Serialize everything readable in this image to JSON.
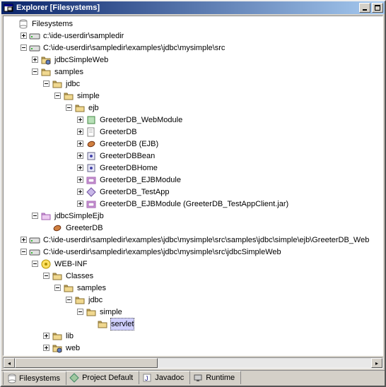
{
  "window": {
    "title": "Explorer [Filesystems]"
  },
  "tree": [
    {
      "i": 0,
      "t": "",
      "k": "filesystems",
      "label": "Filesystems",
      "icon": "filesystems"
    },
    {
      "i": 1,
      "t": "+",
      "k": "drive",
      "label": "c:\\ide-userdir\\sampledir",
      "icon": "drive"
    },
    {
      "i": 1,
      "t": "-",
      "k": "drive",
      "label": "C:\\ide-userdir\\sampledir\\examples\\jdbc\\mysimple\\src",
      "icon": "drive"
    },
    {
      "i": 2,
      "t": "+",
      "k": "webfolder",
      "label": "jdbcSimpleWeb",
      "icon": "webfolder"
    },
    {
      "i": 2,
      "t": "-",
      "k": "folder",
      "label": "samples",
      "icon": "folder"
    },
    {
      "i": 3,
      "t": "-",
      "k": "folder",
      "label": "jdbc",
      "icon": "folder"
    },
    {
      "i": 4,
      "t": "-",
      "k": "folder",
      "label": "simple",
      "icon": "folder"
    },
    {
      "i": 5,
      "t": "-",
      "k": "folder",
      "label": "ejb",
      "icon": "folder"
    },
    {
      "i": 6,
      "t": "+",
      "k": "web",
      "label": "GreeterDB_WebModule",
      "icon": "web"
    },
    {
      "i": 6,
      "t": "+",
      "k": "doc",
      "label": "GreeterDB",
      "icon": "doc"
    },
    {
      "i": 6,
      "t": "+",
      "k": "bean",
      "label": "GreeterDB (EJB)",
      "icon": "bean"
    },
    {
      "i": 6,
      "t": "+",
      "k": "class",
      "label": "GreeterDBBean",
      "icon": "class"
    },
    {
      "i": 6,
      "t": "+",
      "k": "class",
      "label": "GreeterDBHome",
      "icon": "class"
    },
    {
      "i": 6,
      "t": "+",
      "k": "ejbmod",
      "label": "GreeterDB_EJBModule",
      "icon": "ejbmod"
    },
    {
      "i": 6,
      "t": "+",
      "k": "app",
      "label": "GreeterDB_TestApp",
      "icon": "app"
    },
    {
      "i": 6,
      "t": "+",
      "k": "ejbmod",
      "label": "GreeterDB_EJBModule (GreeterDB_TestAppClient.jar)",
      "icon": "ejbmod"
    },
    {
      "i": 2,
      "t": "-",
      "k": "ejbfolder",
      "label": "jdbcSimpleEjb",
      "icon": "ejbfolder"
    },
    {
      "i": 3,
      "t": "",
      "k": "bean",
      "label": "GreeterDB",
      "icon": "bean"
    },
    {
      "i": 1,
      "t": "+",
      "k": "drive",
      "label": "C:\\ide-userdir\\sampledir\\examples\\jdbc\\mysimple\\src\\samples\\jdbc\\simple\\ejb\\GreeterDB_Web",
      "icon": "drive"
    },
    {
      "i": 1,
      "t": "-",
      "k": "drive",
      "label": "C:\\ide-userdir\\sampledir\\examples\\jdbc\\mysimple\\src\\jdbcSimpleWeb",
      "icon": "drive"
    },
    {
      "i": 2,
      "t": "-",
      "k": "webinf",
      "label": "WEB-INF",
      "icon": "webinf"
    },
    {
      "i": 3,
      "t": "-",
      "k": "folder",
      "label": "Classes",
      "icon": "folder"
    },
    {
      "i": 4,
      "t": "-",
      "k": "folder",
      "label": "samples",
      "icon": "folder"
    },
    {
      "i": 5,
      "t": "-",
      "k": "folder",
      "label": "jdbc",
      "icon": "folder"
    },
    {
      "i": 6,
      "t": "-",
      "k": "folder",
      "label": "simple",
      "icon": "folder"
    },
    {
      "i": 7,
      "t": "",
      "k": "folder",
      "label": "servlet",
      "icon": "folder",
      "selected": true
    },
    {
      "i": 3,
      "t": "+",
      "k": "folder",
      "label": "lib",
      "icon": "folder"
    },
    {
      "i": 3,
      "t": "+",
      "k": "folder-web",
      "label": "web",
      "icon": "folder-web"
    }
  ],
  "tabs": [
    {
      "label": "Filesystems",
      "icon": "filesystems",
      "active": true
    },
    {
      "label": "Project Default",
      "icon": "project",
      "active": false
    },
    {
      "label": "Javadoc",
      "icon": "javadoc",
      "active": false
    },
    {
      "label": "Runtime",
      "icon": "runtime",
      "active": false
    }
  ],
  "icons": {
    "filesystems": "fs",
    "drive": "dr",
    "folder": "fo",
    "webfolder": "wf",
    "web": "wb",
    "doc": "dc",
    "bean": "bn",
    "class": "cl",
    "ejbmod": "em",
    "app": "ap",
    "ejbfolder": "ef",
    "webinf": "wi",
    "folder-web": "fw",
    "project": "pj",
    "javadoc": "jd",
    "runtime": "rt"
  }
}
